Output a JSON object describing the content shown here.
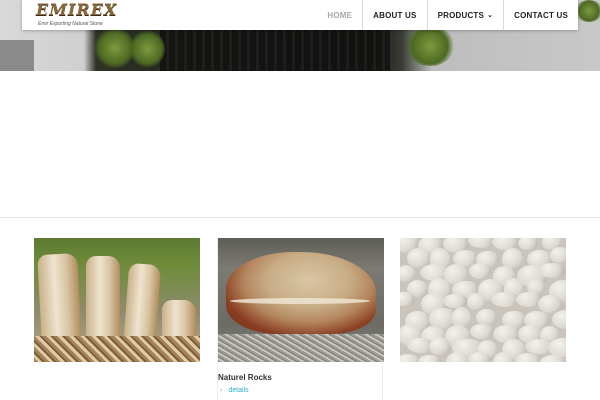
{
  "brand": {
    "logo_word": "EMIREX",
    "tagline": "Emir Exporting Natural Stone"
  },
  "nav": {
    "items": [
      {
        "label": "HOME",
        "active": true
      },
      {
        "label": "ABOUT US"
      },
      {
        "label": "PRODUCTS",
        "has_dropdown": true
      },
      {
        "label": "CONTACT US"
      }
    ],
    "active_color": "#a9a9a9"
  },
  "products": [
    {
      "title": "",
      "details_label": "",
      "image": "standing-stone-pillars"
    },
    {
      "title": "Naturel Rocks",
      "details_label": "details",
      "image": "onyx-rock-boulder"
    },
    {
      "title": "",
      "details_label": "",
      "image": "white-river-pebbles"
    }
  ],
  "colors": {
    "link": "#2bb1c4",
    "logo": "#8a6a3c"
  },
  "icons": {
    "dropdown": "chevron-down-icon",
    "details": "chevron-right-icon"
  }
}
